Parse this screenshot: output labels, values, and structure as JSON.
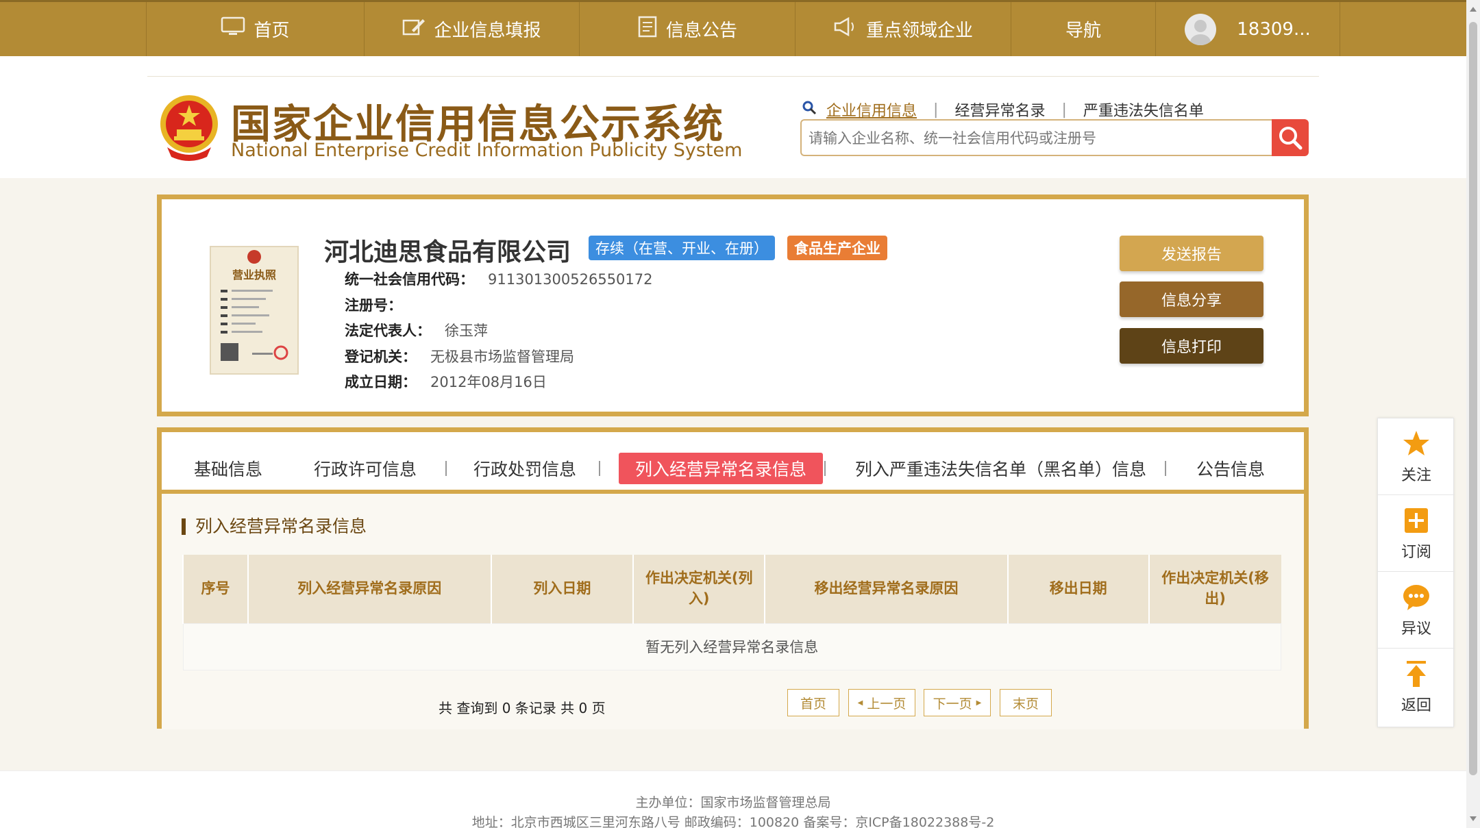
{
  "nav": {
    "items": [
      {
        "label": "首页",
        "icon": "monitor-icon"
      },
      {
        "label": "企业信息填报",
        "icon": "edit-icon"
      },
      {
        "label": "信息公告",
        "icon": "document-icon"
      },
      {
        "label": "重点领域企业",
        "icon": "megaphone-icon"
      },
      {
        "label": "导航",
        "icon": ""
      }
    ],
    "user": "18309..."
  },
  "header": {
    "title_cn": "国家企业信用信息公示系统",
    "title_en": "National Enterprise Credit Information Publicity System",
    "search_tabs": [
      "企业信用信息",
      "经营异常名录",
      "严重违法失信名单"
    ],
    "search_placeholder": "请输入企业名称、统一社会信用代码或注册号"
  },
  "company": {
    "name": "河北迪思食品有限公司",
    "status_badge": "存续（在营、开业、在册）",
    "type_badge": "食品生产企业",
    "fields": [
      {
        "label": "统一社会信用代码：",
        "value": "911301300526550172"
      },
      {
        "label": "注册号：",
        "value": ""
      },
      {
        "label": "法定代表人：",
        "value": "徐玉萍"
      },
      {
        "label": "登记机关：",
        "value": "无极县市场监督管理局"
      },
      {
        "label": "成立日期：",
        "value": "2012年08月16日"
      }
    ],
    "buttons": [
      "发送报告",
      "信息分享",
      "信息打印"
    ],
    "license_title": "营业执照"
  },
  "tabs": [
    "基础信息",
    "行政许可信息",
    "行政处罚信息",
    "列入经营异常名录信息",
    "列入严重违法失信名单（黑名单）信息",
    "公告信息"
  ],
  "active_tab": 3,
  "section": {
    "title": "列入经营异常名录信息",
    "columns": [
      "序号",
      "列入经营异常名录原因",
      "列入日期",
      "作出决定机关(列入)",
      "移出经营异常名录原因",
      "移出日期",
      "作出决定机关(移出)"
    ],
    "empty_text": "暂无列入经营异常名录信息",
    "count_text": "共 查询到 0 条记录 共 0 页",
    "pager": [
      "首页",
      "上一页",
      "下一页",
      "末页"
    ]
  },
  "float_menu": [
    "关注",
    "订阅",
    "异议",
    "返回"
  ],
  "footer": {
    "line1": "主办单位：国家市场监督管理总局",
    "line2": "地址：北京市西城区三里河东路八号   邮政编码：100820   备案号：京ICP备18022388号-2"
  },
  "colors": {
    "nav_bg": "#b38b35",
    "border_gold": "#d4a84b",
    "active_tab": "#f0545c",
    "status_badge": "#3c8ee0",
    "type_badge": "#e97d35"
  }
}
